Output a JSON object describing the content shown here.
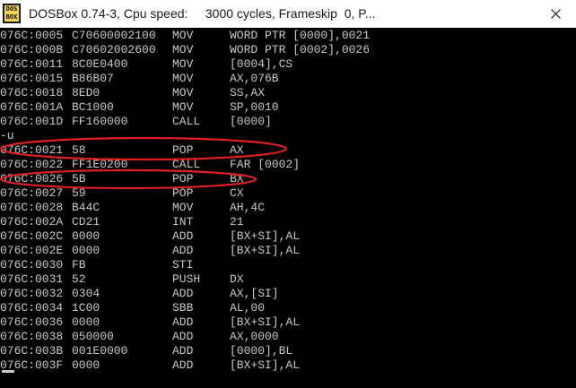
{
  "window": {
    "title": "DOSBox 0.74-3, Cpu speed:     3000 cycles, Frameskip  0, P...",
    "icon_top": "DOS",
    "icon_bottom": "BOX",
    "close_icon": "close-icon"
  },
  "console": {
    "text_color": "#c8c8c8",
    "background": "#000000",
    "lines": [
      {
        "addr": "076C:0005",
        "hex": "C70600002100",
        "mn": "MOV",
        "op": "WORD PTR [0000],0021"
      },
      {
        "addr": "076C:000B",
        "hex": "C70602002600",
        "mn": "MOV",
        "op": "WORD PTR [0002],0026"
      },
      {
        "addr": "076C:0011",
        "hex": "8C0E0400",
        "mn": "MOV",
        "op": "[0004],CS"
      },
      {
        "addr": "076C:0015",
        "hex": "B86B07",
        "mn": "MOV",
        "op": "AX,076B"
      },
      {
        "addr": "076C:0018",
        "hex": "8ED0",
        "mn": "MOV",
        "op": "SS,AX"
      },
      {
        "addr": "076C:001A",
        "hex": "BC1000",
        "mn": "MOV",
        "op": "SP,0010"
      },
      {
        "addr": "076C:001D",
        "hex": "FF160000",
        "mn": "CALL",
        "op": "[0000]"
      },
      {
        "addr": "-u",
        "hex": "",
        "mn": "",
        "op": ""
      },
      {
        "addr": "076C:0021",
        "hex": "58",
        "mn": "POP",
        "op": "AX"
      },
      {
        "addr": "076C:0022",
        "hex": "FF1E0200",
        "mn": "CALL",
        "op": "FAR [0002]"
      },
      {
        "addr": "076C:0026",
        "hex": "5B",
        "mn": "POP",
        "op": "BX"
      },
      {
        "addr": "076C:0027",
        "hex": "59",
        "mn": "POP",
        "op": "CX"
      },
      {
        "addr": "076C:0028",
        "hex": "B44C",
        "mn": "MOV",
        "op": "AH,4C"
      },
      {
        "addr": "076C:002A",
        "hex": "CD21",
        "mn": "INT",
        "op": "21"
      },
      {
        "addr": "076C:002C",
        "hex": "0000",
        "mn": "ADD",
        "op": "[BX+SI],AL"
      },
      {
        "addr": "076C:002E",
        "hex": "0000",
        "mn": "ADD",
        "op": "[BX+SI],AL"
      },
      {
        "addr": "076C:0030",
        "hex": "FB",
        "mn": "STI",
        "op": ""
      },
      {
        "addr": "076C:0031",
        "hex": "52",
        "mn": "PUSH",
        "op": "DX"
      },
      {
        "addr": "076C:0032",
        "hex": "0304",
        "mn": "ADD",
        "op": "AX,[SI]"
      },
      {
        "addr": "076C:0034",
        "hex": "1C00",
        "mn": "SBB",
        "op": "AL,00"
      },
      {
        "addr": "076C:0036",
        "hex": "0000",
        "mn": "ADD",
        "op": "[BX+SI],AL"
      },
      {
        "addr": "076C:0038",
        "hex": "050000",
        "mn": "ADD",
        "op": "AX,0000"
      },
      {
        "addr": "076C:003B",
        "hex": "001E0000",
        "mn": "ADD",
        "op": "[0000],BL"
      },
      {
        "addr": "076C:003F",
        "hex": "0000",
        "mn": "ADD",
        "op": "[BX+SI],AL"
      },
      {
        "addr": "-",
        "hex": "",
        "mn": "",
        "op": ""
      }
    ]
  },
  "annotations": {
    "ellipse_color": "#e0201e",
    "highlighted_lines": [
      "076C:0021",
      "076C:0026"
    ]
  }
}
